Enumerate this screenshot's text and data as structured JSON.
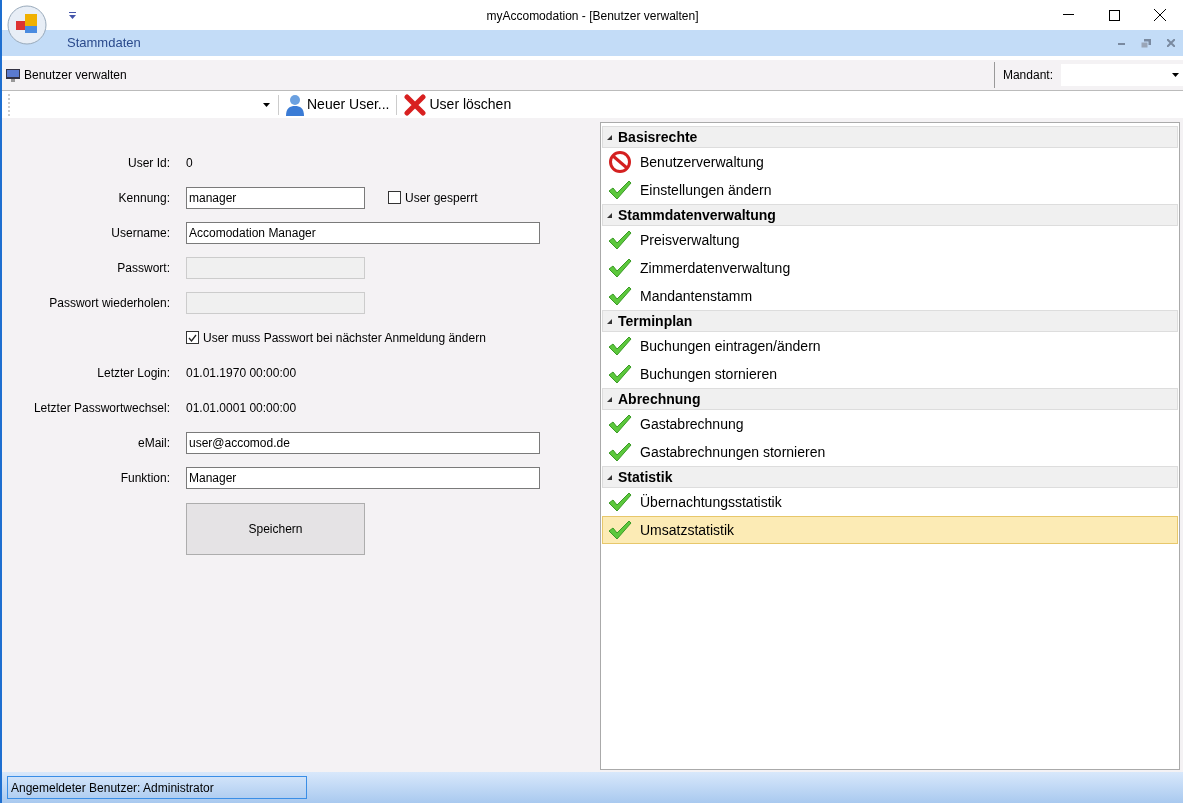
{
  "window": {
    "title": "myAccomodation - [Benutzer verwalten]"
  },
  "ribbon": {
    "tab": "Stammdaten"
  },
  "view": {
    "title": "Benutzer verwalten",
    "mandant_label": "Mandant:"
  },
  "actions": [
    {
      "kind": "new",
      "label": "Neuer User..."
    },
    {
      "kind": "delete",
      "label": "User löschen"
    }
  ],
  "form": [
    {
      "kind": "text",
      "label": "User Id:",
      "value": "0"
    },
    {
      "kind": "short_input",
      "label": "Kennung:",
      "value": "manager",
      "disabled": false,
      "checkbox": {
        "label": "User gesperrt",
        "checked": false
      }
    },
    {
      "kind": "input",
      "label": "Username:",
      "value": "Accomodation Manager",
      "disabled": false
    },
    {
      "kind": "short_input",
      "label": "Passwort:",
      "disabled": true
    },
    {
      "kind": "short_input",
      "label": "Passwort wiederholen:",
      "disabled": true
    },
    {
      "kind": "checkbox",
      "label": "User muss Passwort bei nächster Anmeldung ändern",
      "checked": true
    },
    {
      "kind": "text",
      "label": "Letzter Login:",
      "value": "01.01.1970 00:00:00"
    },
    {
      "kind": "text",
      "label": "Letzter Passwortwechsel:",
      "value": "01.01.0001 00:00:00"
    },
    {
      "kind": "input",
      "label": "eMail:",
      "value": "user@accomod.de",
      "disabled": false
    },
    {
      "kind": "input",
      "label": "Funktion:",
      "value": "Manager",
      "disabled": false
    },
    {
      "kind": "button",
      "label": "Speichern"
    }
  ],
  "rights": [
    {
      "label": "Basisrechte",
      "expanded": true,
      "children": [
        {
          "label": "Benutzerverwaltung",
          "granted": false,
          "selected": false
        },
        {
          "label": "Einstellungen ändern",
          "granted": true,
          "selected": false
        }
      ]
    },
    {
      "label": "Stammdatenverwaltung",
      "expanded": true,
      "children": [
        {
          "label": "Preisverwaltung",
          "granted": true,
          "selected": false
        },
        {
          "label": "Zimmerdatenverwaltung",
          "granted": true,
          "selected": false
        },
        {
          "label": "Mandantenstamm",
          "granted": true,
          "selected": false
        }
      ]
    },
    {
      "label": "Terminplan",
      "expanded": true,
      "children": [
        {
          "label": "Buchungen eintragen/ändern",
          "granted": true,
          "selected": false
        },
        {
          "label": "Buchungen stornieren",
          "granted": true,
          "selected": false
        }
      ]
    },
    {
      "label": "Abrechnung",
      "expanded": true,
      "children": [
        {
          "label": "Gastabrechnung",
          "granted": true,
          "selected": false
        },
        {
          "label": "Gastabrechnungen stornieren",
          "granted": true,
          "selected": false
        }
      ]
    },
    {
      "label": "Statistik",
      "expanded": true,
      "children": [
        {
          "label": "Übernachtungsstatistik",
          "granted": true,
          "selected": false
        },
        {
          "label": "Umsatzstatistik",
          "granted": true,
          "selected": true
        }
      ]
    }
  ],
  "status_bar": {
    "text": "Angemeldeter Benutzer: Administrator"
  }
}
